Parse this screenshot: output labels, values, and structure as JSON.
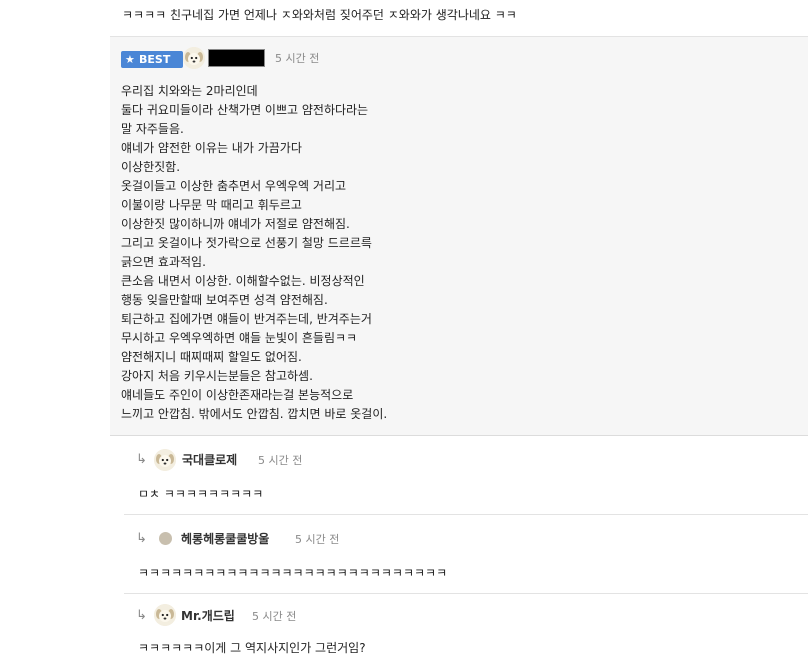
{
  "top_comment": {
    "text": "ㅋㅋㅋㅋ 친구네집 가면 언제나 ㅈ와와처럼 짖어주던 ㅈ와와가 생각나네요 ㅋㅋ"
  },
  "best_comment": {
    "badge_label": "BEST",
    "author_name": "",
    "time": "5 시간 전",
    "lines": [
      "우리집 치와와는 2마리인데",
      "둘다 귀요미들이라 산책가면 이쁘고 얌전하다라는",
      "말 자주들음.",
      "얘네가 얌전한 이유는 내가 가끔가다",
      "이상한짓함.",
      "옷걸이들고 이상한 춤추면서 우엑우엑 거리고",
      "이불이랑 나무문 막 때리고 휘두르고",
      "이상한짓 많이하니까 얘네가 저절로 얌전해짐.",
      "그리고 옷걸이나 젓가락으로 선풍기 철망 드르르륵",
      "긁으면 효과적임.",
      "큰소음 내면서 이상한. 이해할수없는. 비정상적인",
      "행동 잊을만할때 보여주면 성격 얌전해짐.",
      "퇴근하고 집에가면 얘들이 반겨주는데, 반겨주는거",
      "무시하고 우엑우엑하면 얘들 눈빛이 흔들림ㅋㅋ",
      "얌전해지니 때찌때찌 할일도 없어짐.",
      "강아지 처음 키우시는분들은 참고하셈.",
      "얘네들도 주인이 이상한존재라는걸 본능적으로",
      "느끼고 안깝침. 밖에서도 안깝침. 깝치면 바로 옷걸이."
    ]
  },
  "replies": [
    {
      "name": "국대클로제",
      "time": "5 시간 전",
      "text": "ㅁㅊ ㅋㅋㅋㅋㅋㅋㅋㅋㅋ"
    },
    {
      "name": "헤롱헤롱쿨쿨방울",
      "time": "5 시간 전",
      "text": "ㅋㅋㅋㅋㅋㅋㅋㅋㅋㅋㅋㅋㅋㅋㅋㅋㅋㅋㅋㅋㅋㅋㅋㅋㅋㅋㅋㅋ"
    },
    {
      "name": "Mr.개드립",
      "time": "5 시간 전",
      "text": "ㅋㅋㅋㅋㅋㅋ이게 그 역지사지인가 그런거임?"
    }
  ],
  "icons": {
    "best_star": "star-icon",
    "reply_arrow": "reply-arrow-icon",
    "avatar": "puppy-avatar-icon"
  },
  "colors": {
    "best_badge": "#4a86d6",
    "best_background": "#f6f6f6",
    "time_text": "#8a8a8a"
  }
}
